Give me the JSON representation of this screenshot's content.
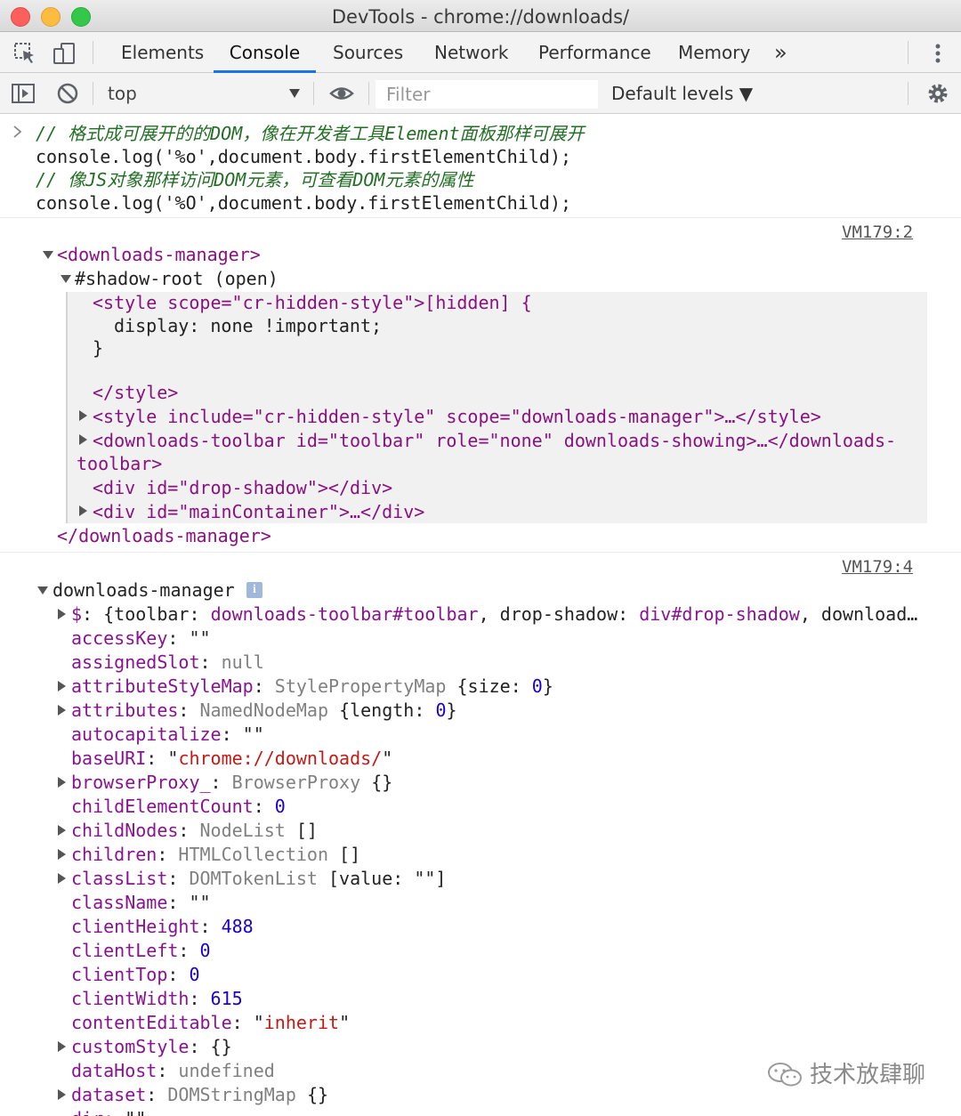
{
  "window": {
    "title": "DevTools - chrome://downloads/"
  },
  "tabs": [
    "Elements",
    "Console",
    "Sources",
    "Network",
    "Performance",
    "Memory"
  ],
  "tabs_more": "»",
  "active_tab": "Console",
  "console_toolbar": {
    "context": "top",
    "filter_placeholder": "Filter",
    "levels": "Default levels ▼"
  },
  "input_code": {
    "line1": "// 格式成可展开的的DOM，像在开发者工具Element面板那样可展开",
    "line2": "console.log('%o',document.body.firstElementChild);",
    "line3": "// 像JS对象那样访问DOM元素，可查看DOM元素的属性",
    "line4": "console.log('%O',document.body.firstElementChild);"
  },
  "messages": {
    "m1_source": "VM179:2",
    "m2_source": "VM179:4"
  },
  "dom_tree": {
    "root_open": "<downloads-manager>",
    "shadow_root": "#shadow-root (open)",
    "style1_open": "<style scope=\"cr-hidden-style\">[hidden] {",
    "style1_body": "display: none !important;",
    "style1_brace": "}",
    "style1_close": "</style>",
    "style2": "<style include=\"cr-hidden-style\" scope=\"downloads-manager\">…</style>",
    "toolbar_a": "<downloads-toolbar id=\"toolbar\" role=\"none\" downloads-showing>…</downloads-",
    "toolbar_b": "toolbar>",
    "drop_shadow": "<div id=\"drop-shadow\"></div>",
    "main_container": "<div id=\"mainContainer\">…</div>",
    "root_close": "</downloads-manager>"
  },
  "object_view": {
    "header": "downloads-manager",
    "props": [
      {
        "expand": true,
        "key": "$",
        "parts": [
          [
            "plain",
            "{toolbar: "
          ],
          [
            "prop",
            "downloads-toolbar#toolbar"
          ],
          [
            "plain",
            ", drop-shadow: "
          ],
          [
            "prop",
            "div#drop-shadow"
          ],
          [
            "plain",
            ", download…"
          ]
        ]
      },
      {
        "expand": false,
        "key": "accessKey",
        "parts": [
          [
            "plain",
            "\"\""
          ]
        ]
      },
      {
        "expand": false,
        "key": "assignedSlot",
        "parts": [
          [
            "null",
            "null"
          ]
        ]
      },
      {
        "expand": true,
        "key": "attributeStyleMap",
        "parts": [
          [
            "type",
            "StylePropertyMap "
          ],
          [
            "plain",
            "{size: "
          ],
          [
            "num",
            "0"
          ],
          [
            "plain",
            "}"
          ]
        ]
      },
      {
        "expand": true,
        "key": "attributes",
        "parts": [
          [
            "type",
            "NamedNodeMap "
          ],
          [
            "plain",
            "{length: "
          ],
          [
            "num",
            "0"
          ],
          [
            "plain",
            "}"
          ]
        ]
      },
      {
        "expand": false,
        "key": "autocapitalize",
        "parts": [
          [
            "plain",
            "\"\""
          ]
        ]
      },
      {
        "expand": false,
        "key": "baseURI",
        "parts": [
          [
            "plain",
            "\""
          ],
          [
            "str",
            "chrome://downloads/"
          ],
          [
            "plain",
            "\""
          ]
        ]
      },
      {
        "expand": true,
        "key": "browserProxy_",
        "parts": [
          [
            "type",
            "BrowserProxy "
          ],
          [
            "plain",
            "{}"
          ]
        ]
      },
      {
        "expand": false,
        "key": "childElementCount",
        "parts": [
          [
            "num",
            "0"
          ]
        ]
      },
      {
        "expand": true,
        "key": "childNodes",
        "parts": [
          [
            "type",
            "NodeList "
          ],
          [
            "plain",
            "[]"
          ]
        ]
      },
      {
        "expand": true,
        "key": "children",
        "parts": [
          [
            "type",
            "HTMLCollection "
          ],
          [
            "plain",
            "[]"
          ]
        ]
      },
      {
        "expand": true,
        "key": "classList",
        "parts": [
          [
            "type",
            "DOMTokenList "
          ],
          [
            "plain",
            "[value: \""
          ],
          [
            "str",
            ""
          ],
          [
            "plain",
            "\"]"
          ]
        ]
      },
      {
        "expand": false,
        "key": "className",
        "parts": [
          [
            "plain",
            "\"\""
          ]
        ]
      },
      {
        "expand": false,
        "key": "clientHeight",
        "parts": [
          [
            "num",
            "488"
          ]
        ]
      },
      {
        "expand": false,
        "key": "clientLeft",
        "parts": [
          [
            "num",
            "0"
          ]
        ]
      },
      {
        "expand": false,
        "key": "clientTop",
        "parts": [
          [
            "num",
            "0"
          ]
        ]
      },
      {
        "expand": false,
        "key": "clientWidth",
        "parts": [
          [
            "num",
            "615"
          ]
        ]
      },
      {
        "expand": false,
        "key": "contentEditable",
        "parts": [
          [
            "plain",
            "\""
          ],
          [
            "str",
            "inherit"
          ],
          [
            "plain",
            "\""
          ]
        ]
      },
      {
        "expand": true,
        "key": "customStyle",
        "parts": [
          [
            "plain",
            "{}"
          ]
        ]
      },
      {
        "expand": false,
        "key": "dataHost",
        "parts": [
          [
            "null",
            "undefined"
          ]
        ]
      },
      {
        "expand": true,
        "key": "dataset",
        "parts": [
          [
            "type",
            "DOMStringMap "
          ],
          [
            "plain",
            "{}"
          ]
        ]
      },
      {
        "expand": false,
        "key": "dir",
        "parts": [
          [
            "plain",
            "\"\""
          ]
        ]
      }
    ]
  },
  "watermark": "技术放肆聊"
}
